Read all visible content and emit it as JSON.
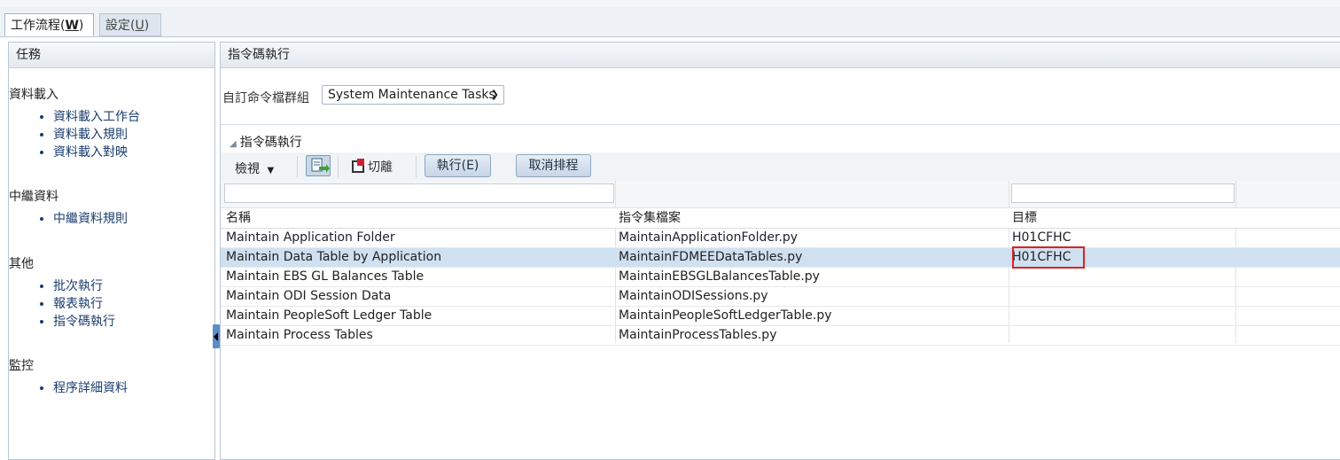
{
  "tabs": [
    {
      "label": "工作流程(",
      "hotkey": "W",
      "suffix": ")"
    },
    {
      "label": "設定(",
      "hotkey": "U",
      "suffix": ")"
    }
  ],
  "left_panel": {
    "title": "任務",
    "sections": [
      {
        "heading": "資料載入",
        "items": [
          "資料載入工作台",
          "資料載入規則",
          "資料載入對映"
        ]
      },
      {
        "heading": "中繼資料",
        "items": [
          "中繼資料規則"
        ]
      },
      {
        "heading": "其他",
        "items": [
          "批次執行",
          "報表執行",
          "指令碼執行"
        ]
      },
      {
        "heading": "監控",
        "items": [
          "程序詳細資料"
        ]
      }
    ]
  },
  "right_panel": {
    "title": "指令碼執行",
    "group_label": "自訂命令檔群組",
    "group_value": "System Maintenance Tasks",
    "subheading": "指令碼執行",
    "toolbar": {
      "view_label": "檢視",
      "detach_label": "切離",
      "run_label": "執行(E)",
      "cancel_label": "取消排程"
    },
    "columns": [
      "名稱",
      "指令集檔案",
      "目標"
    ],
    "rows": [
      {
        "name": "Maintain Application Folder",
        "file": "MaintainApplicationFolder.py",
        "target": "H01CFHC"
      },
      {
        "name": "Maintain Data Table by Application",
        "file": "MaintainFDMEEDataTables.py",
        "target": "H01CFHC"
      },
      {
        "name": "Maintain EBS GL Balances Table",
        "file": "MaintainEBSGLBalancesTable.py",
        "target": ""
      },
      {
        "name": "Maintain ODI Session Data",
        "file": "MaintainODISessions.py",
        "target": ""
      },
      {
        "name": "Maintain PeopleSoft Ledger Table",
        "file": "MaintainPeopleSoftLedgerTable.py",
        "target": ""
      },
      {
        "name": "Maintain Process Tables",
        "file": "MaintainProcessTables.py",
        "target": ""
      }
    ],
    "selected_row": 1
  },
  "colors": {
    "selected_row": "#cfe0f1",
    "highlight_box": "#e02020",
    "link": "#1a3d6e"
  }
}
